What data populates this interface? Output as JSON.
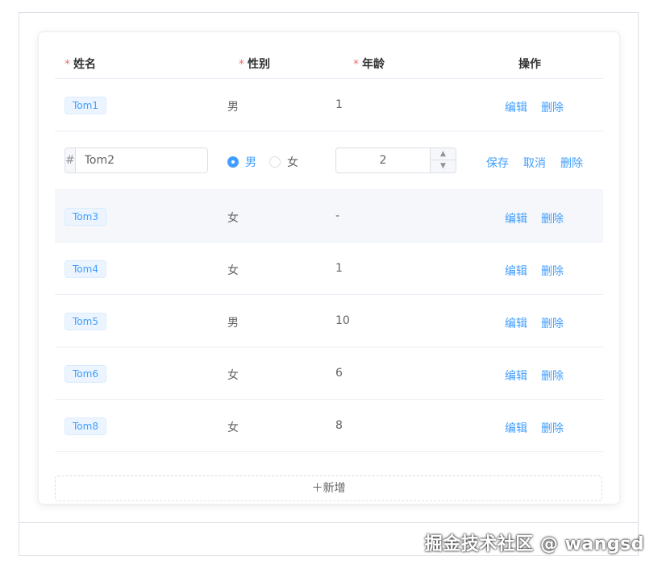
{
  "table": {
    "headers": {
      "required_mark": "*",
      "name": "姓名",
      "sex": "性别",
      "age": "年龄",
      "ops": "操作"
    },
    "rows": [
      {
        "name": "Tom1",
        "sex": "男",
        "age": "1"
      },
      {
        "name": "Tom3",
        "sex": "女",
        "age": "-"
      },
      {
        "name": "Tom4",
        "sex": "女",
        "age": "1"
      },
      {
        "name": "Tom5",
        "sex": "男",
        "age": "10"
      },
      {
        "name": "Tom6",
        "sex": "女",
        "age": "6"
      },
      {
        "name": "Tom8",
        "sex": "女",
        "age": "8"
      }
    ],
    "edit_row": {
      "prepend": "#",
      "name_value": "Tom2",
      "radio_male": "男",
      "radio_female": "女",
      "age_value": "2",
      "up_icon": "▲",
      "down_icon": "▼"
    },
    "actions": {
      "edit": "编辑",
      "delete": "删除",
      "save": "保存",
      "cancel": "取消"
    }
  },
  "add_button": "＋新增",
  "watermark": "掘金技术社区 @ wangsd",
  "colors": {
    "primary": "#409eff",
    "required": "#f56c6c",
    "border": "#ebeef5"
  }
}
